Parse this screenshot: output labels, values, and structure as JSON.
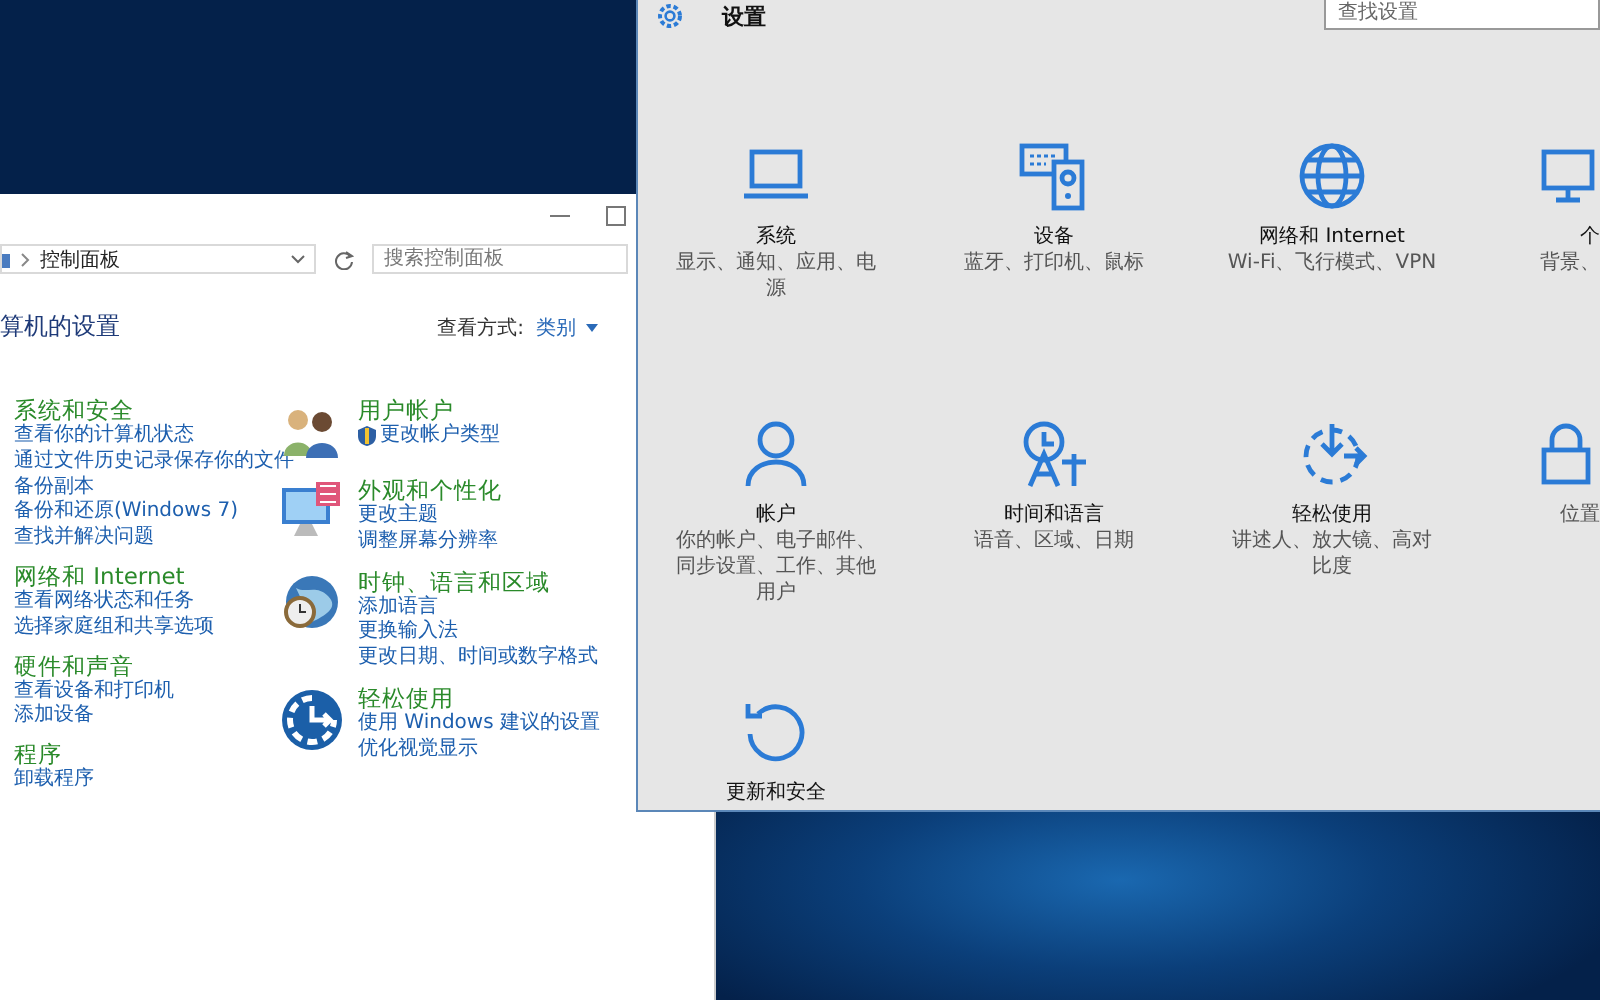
{
  "control_panel": {
    "address": {
      "path": "控制面板"
    },
    "search": {
      "placeholder": "搜索控制面板"
    },
    "heading": "算机的设置",
    "view_by": {
      "label": "查看方式:",
      "value": "类别"
    },
    "columns": [
      [
        {
          "title": "系统和安全",
          "links": [
            {
              "text": "查看你的计算机状态",
              "admin": false
            },
            {
              "text": "通过文件历史记录保存你的文件",
              "admin": false
            },
            {
              "text": "备份副本",
              "admin": false
            },
            {
              "text": "备份和还原(Windows 7)",
              "admin": false
            },
            {
              "text": "查找并解决问题",
              "admin": false
            }
          ]
        },
        {
          "title": "网络和 Internet",
          "links": [
            {
              "text": "查看网络状态和任务",
              "admin": false
            },
            {
              "text": "选择家庭组和共享选项",
              "admin": false
            }
          ]
        },
        {
          "title": "硬件和声音",
          "links": [
            {
              "text": "查看设备和打印机",
              "admin": false
            },
            {
              "text": "添加设备",
              "admin": false
            }
          ]
        },
        {
          "title": "程序",
          "links": [
            {
              "text": "卸载程序",
              "admin": false
            }
          ]
        }
      ],
      [
        {
          "title": "用户帐户",
          "links": [
            {
              "text": "更改帐户类型",
              "admin": true
            }
          ]
        },
        {
          "title": "外观和个性化",
          "links": [
            {
              "text": "更改主题",
              "admin": false
            },
            {
              "text": "调整屏幕分辨率",
              "admin": false
            }
          ]
        },
        {
          "title": "时钟、语言和区域",
          "links": [
            {
              "text": "添加语言",
              "admin": false
            },
            {
              "text": "更换输入法",
              "admin": false
            },
            {
              "text": "更改日期、时间或数字格式",
              "admin": false
            }
          ]
        },
        {
          "title": "轻松使用",
          "links": [
            {
              "text": "使用 Windows 建议的设置",
              "admin": false
            },
            {
              "text": "优化视觉显示",
              "admin": false
            }
          ]
        }
      ]
    ]
  },
  "settings": {
    "title": "设置",
    "search": {
      "placeholder": "查找设置"
    },
    "items": [
      {
        "title": "系统",
        "description": "显示、通知、应用、电源"
      },
      {
        "title": "设备",
        "description": "蓝牙、打印机、鼠标"
      },
      {
        "title": "网络和 Internet",
        "description": "Wi-Fi、飞行模式、VPN"
      },
      {
        "title": "个",
        "description": "背景、"
      },
      {
        "title": "帐户",
        "description": "你的帐户、电子邮件、同步设置、工作、其他用户"
      },
      {
        "title": "时间和语言",
        "description": "语音、区域、日期"
      },
      {
        "title": "轻松使用",
        "description": "讲述人、放大镜、高对比度"
      },
      {
        "description": "位置"
      },
      {
        "title": "更新和安全"
      }
    ]
  }
}
